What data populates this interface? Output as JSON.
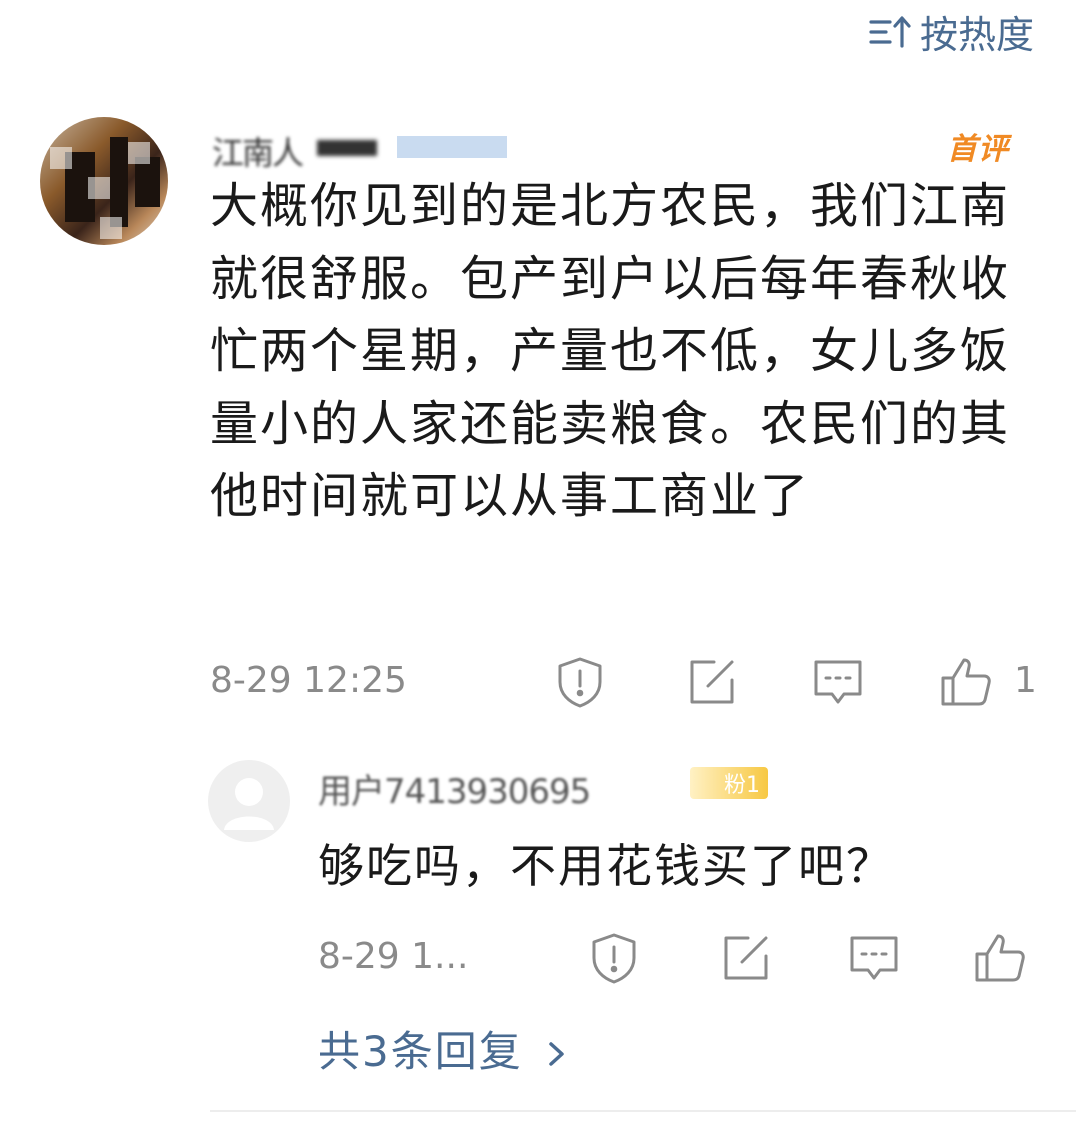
{
  "sort": {
    "label": "按热度",
    "icon": "sort-icon"
  },
  "comment": {
    "avatar": "user-avatar",
    "username": "江南人",
    "badge": "首评",
    "text": "大概你见到的是北方农民，我们江南就很舒服。包产到户以后每年春秋收忙两个星期，产量也不低，女儿多饭量小的人家还能卖粮食。农民们的其他时间就可以从事工商业了",
    "time": "8-29 12:25",
    "like_count": "1",
    "icons": [
      "report-icon",
      "edit-icon",
      "comment-icon",
      "like-icon"
    ]
  },
  "reply": {
    "avatar": "default-avatar",
    "username": "用户7413930695",
    "fan_badge": "粉1",
    "text": "够吃吗，不用花钱买了吧？",
    "time": "8-29 1...",
    "icons": [
      "report-icon",
      "edit-icon",
      "comment-icon",
      "like-icon"
    ]
  },
  "more_replies": {
    "label": "共3条回复"
  },
  "colors": {
    "link": "#4a6b91",
    "meta": "#8a8a8a",
    "badge": "#f08a24"
  }
}
